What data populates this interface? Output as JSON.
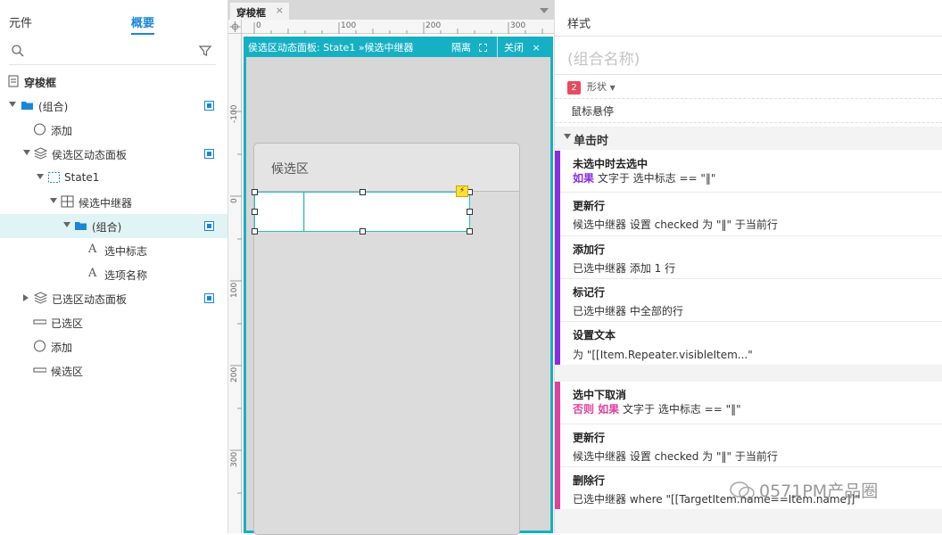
{
  "left": {
    "tabs": [
      "元件",
      "概要"
    ],
    "active_tab": "概要",
    "tree": [
      {
        "label": "穿梭框",
        "icon": "page-icon",
        "bold": true
      },
      {
        "label": "(组合)",
        "icon": "folder-icon",
        "badge": true
      },
      {
        "label": "添加",
        "icon": "circle-icon"
      },
      {
        "label": "侯选区动态面板",
        "icon": "dynamic-panel-icon",
        "badge": true
      },
      {
        "label": "State1",
        "icon": "state-icon"
      },
      {
        "label": "候选中继器",
        "icon": "repeater-icon"
      },
      {
        "label": "(组合)",
        "icon": "folder-icon",
        "badge": true
      },
      {
        "label": "选中标志",
        "icon": "text-icon"
      },
      {
        "label": "选项名称",
        "icon": "text-icon"
      },
      {
        "label": "已选区动态面板",
        "icon": "dynamic-panel-icon",
        "badge": true
      },
      {
        "label": "已选区",
        "icon": "rect-icon"
      },
      {
        "label": "添加",
        "icon": "circle-icon"
      },
      {
        "label": "候选区",
        "icon": "rect-icon"
      }
    ]
  },
  "center": {
    "tab": "穿梭框",
    "ruler_top": [
      "0",
      "100",
      "200",
      "300"
    ],
    "ruler_left": [
      "-100",
      "0",
      "100",
      "200",
      "300"
    ],
    "edit_bar": {
      "path": "侯选区动态面板: State1  »候选中继器",
      "isolate": "隔离",
      "close": "关闭"
    },
    "panel_title": "候选区"
  },
  "right": {
    "header": "样式",
    "group_name_placeholder": "(组合名称)",
    "shape_count": "2",
    "shape_label": "形状",
    "hover": "鼠标悬停",
    "event": "单击时",
    "case1": {
      "title": "未选中时去选中",
      "cond_kw": "如果",
      "cond": "文字于 选中标志 == \"‖\"",
      "color": "#8a2be2"
    },
    "case1_actions": [
      {
        "title": "更新行",
        "desc": "候选中继器 设置 checked 为 \"‖\" 于当前行"
      },
      {
        "title": "添加行",
        "desc": "已选中继器 添加 1 行"
      },
      {
        "title": "标记行",
        "desc": "已选中继器 中全部的行"
      },
      {
        "title": "设置文本",
        "desc": "为 \"[[Item.Repeater.visibleItem...\""
      }
    ],
    "case2": {
      "title": "选中下取消",
      "cond_kw": "否则 如果",
      "cond": "文字于 选中标志 == \"‖\"",
      "color": "#e0409e"
    },
    "case2_actions": [
      {
        "title": "更新行",
        "desc": "候选中继器 设置 checked 为 \"‖\" 于当前行"
      },
      {
        "title": "删除行",
        "desc": "已选中继器 where \"[[TargetItem.name==Item.name]]\""
      }
    ],
    "watermark": "0571PM产品圈"
  }
}
